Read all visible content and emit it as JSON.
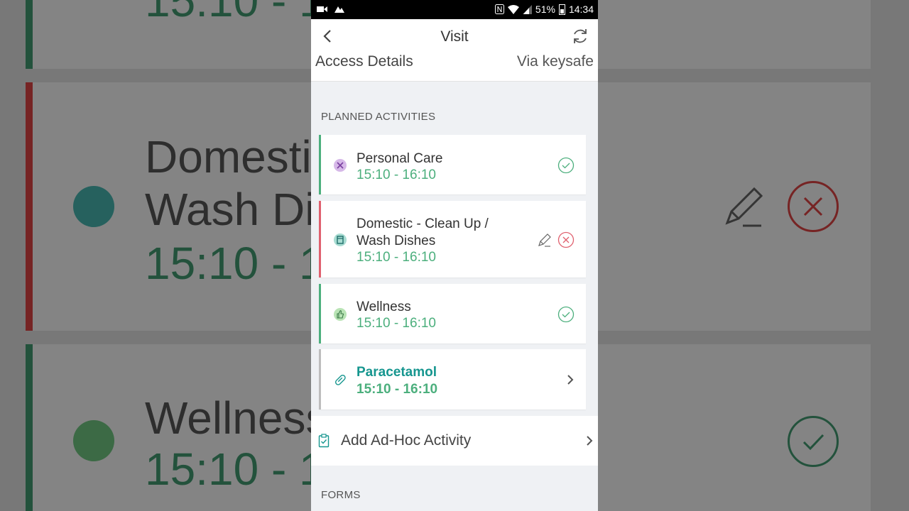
{
  "status_bar": {
    "battery_percent": "51%",
    "clock": "14:34",
    "left_icons": [
      "video-icon",
      "gallery-icon"
    ],
    "right_icons": [
      "nfc-icon",
      "wifi-icon",
      "signal-icon",
      "battery-icon"
    ]
  },
  "appbar": {
    "title": "Visit",
    "back_icon": "chevron-left-icon",
    "refresh_icon": "refresh-icon"
  },
  "access": {
    "label": "Access Details",
    "value": "Via keysafe"
  },
  "planned_activities": {
    "section_title": "PLANNED ACTIVITIES",
    "items": [
      {
        "name": "Personal Care",
        "time": "15:10 - 16:10",
        "icon": "personal-care-icon",
        "status": "completed",
        "strip_color": "#4caf7d"
      },
      {
        "name_line1": "Domestic - Clean Up /",
        "name_line2": "Wash Dishes",
        "time": "15:10 - 16:10",
        "icon": "dishwasher-icon",
        "status": "not-completed",
        "strip_color": "#e0606e"
      },
      {
        "name": "Wellness",
        "time": "15:10 - 16:10",
        "icon": "thumbs-up-icon",
        "status": "completed",
        "strip_color": "#4caf7d"
      },
      {
        "name": "Paracetamol",
        "time": "15:10 - 16:10",
        "icon": "pill-icon",
        "status": "pending",
        "strip_color": "#bdbdbd"
      }
    ]
  },
  "adhoc": {
    "label": "Add Ad-Hoc Activity",
    "icon": "clipboard-check-icon"
  },
  "forms": {
    "section_title": "FORMS"
  },
  "background": {
    "title_1": "Domestic",
    "title_2": "Wash Di",
    "time": "15:10 - 1",
    "title_top_time": "15:10 - 1",
    "title_wellness": "Wellness"
  },
  "colors": {
    "accent_green": "#4caf7d",
    "accent_red": "#e0606e",
    "medication_teal": "#16968f"
  }
}
